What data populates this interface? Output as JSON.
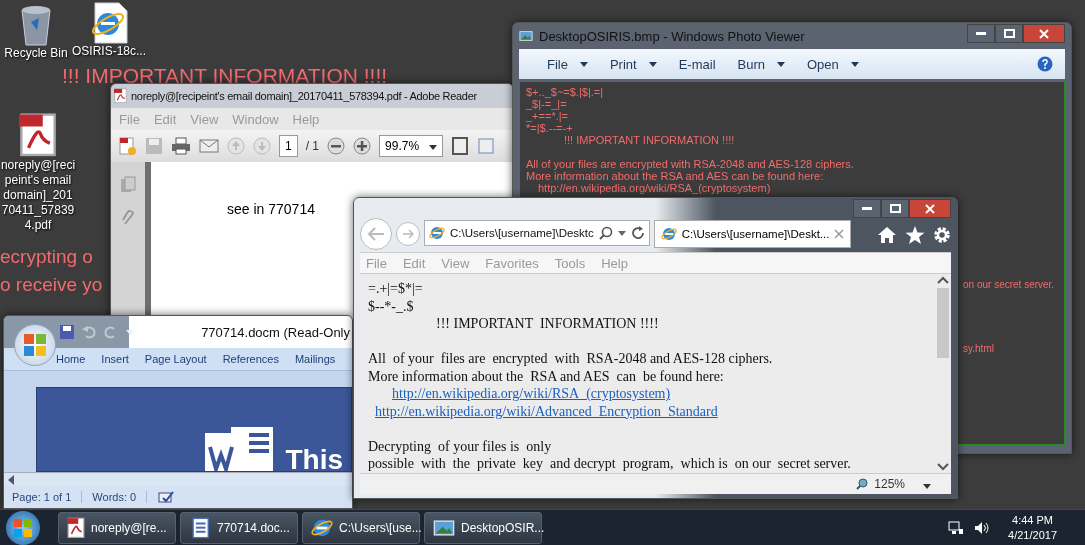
{
  "desktop": {
    "wallpaper_text": [
      "!!! IMPORTANT INFORMATION !!!!",
      "ecrypting o",
      "o receive yo"
    ],
    "icons": [
      {
        "kind": "recycle",
        "label": "Recycle Bin"
      },
      {
        "kind": "ie",
        "label": "OSIRIS-18c..."
      },
      {
        "kind": "pdf",
        "label": "noreply@[recipeint's email domain]_20170411_578394.pdf"
      }
    ]
  },
  "pdf_reader": {
    "title": "noreply@[recipeint's email domain]_20170411_578394.pdf - Adobe Reader",
    "menu": [
      {
        "label": "File",
        "disabled": true
      },
      {
        "label": "Edit",
        "disabled": true
      },
      {
        "label": "View",
        "disabled": true
      },
      {
        "label": "Window",
        "disabled": true
      },
      {
        "label": "Help",
        "disabled": true
      }
    ],
    "page": "1",
    "page_count": "/ 1",
    "zoom": "99.7%",
    "page_text": "see in 770714"
  },
  "photo_viewer": {
    "title": "DesktopOSIRIS.bmp - Windows Photo Viewer",
    "menu": [
      {
        "label": "File",
        "dropdown": true
      },
      {
        "label": "Print",
        "dropdown": true
      },
      {
        "label": "E-mail",
        "dropdown": false
      },
      {
        "label": "Burn",
        "dropdown": true
      },
      {
        "label": "Open",
        "dropdown": true
      }
    ],
    "lines": [
      {
        "kind": "text",
        "text": "$+.._$~=$.|$|.=|"
      },
      {
        "kind": "text",
        "text": "_$|-=_|="
      },
      {
        "kind": "text",
        "text": "_+==*.|="
      },
      {
        "kind": "text",
        "text": "*=|$.--=-+"
      },
      {
        "kind": "title",
        "text": "!!! IMPORTANT INFORMATION !!!!"
      },
      {
        "kind": "blank"
      },
      {
        "kind": "text",
        "text": "All of your files are encrypted with RSA-2048 and AES-128 ciphers."
      },
      {
        "kind": "text",
        "text": "More information about the RSA and AES can be found here:"
      },
      {
        "kind": "link",
        "text": "http://en.wikipedia.org/wiki/RSA_(cryptosystem)"
      }
    ],
    "fragments": [
      "on our secret server.",
      "sy.html"
    ]
  },
  "browser": {
    "address": "C:\\Users\\[username]\\Desktc",
    "tab": {
      "title": "C:\\Users\\[username]\\Deskt...",
      "selected": true
    },
    "menu": [
      "File",
      "Edit",
      "View",
      "Favorites",
      "Tools",
      "Help"
    ],
    "lines": [
      {
        "kind": "text",
        "text": "=.+|=$*|="
      },
      {
        "kind": "text",
        "text": "$--*-_.$"
      },
      {
        "kind": "title",
        "text": "!!! IMPORTANT  INFORMATION !!!!"
      },
      {
        "kind": "blank"
      },
      {
        "kind": "text",
        "text": "All  of your  files are  encrypted  with  RSA-2048 and AES-128 ciphers."
      },
      {
        "kind": "text",
        "text": "More information about the  RSA and AES  can  be found here:"
      },
      {
        "kind": "link",
        "text": "http://en.wikipedia.org/wiki/RSA_(cryptosystem)"
      },
      {
        "kind": "link2",
        "text": "http://en.wikipedia.org/wiki/Advanced_Encryption_Standard"
      },
      {
        "kind": "blank"
      },
      {
        "kind": "text",
        "text": "Decrypting  of your files is  only"
      },
      {
        "kind": "text",
        "text": "possible  with  the  private  key  and decrypt  program,  which is  on our  secret server."
      }
    ],
    "zoom": "125%"
  },
  "word": {
    "title": "770714.docm (Read-Only",
    "ribbon_tabs": [
      "Home",
      "Insert",
      "Page Layout",
      "References",
      "Mailings"
    ],
    "document_text": "This",
    "status": [
      "Page: 1 of 1",
      "Words: 0"
    ]
  },
  "taskbar": {
    "buttons": [
      {
        "kind": "pdf",
        "label": "noreply@[re..."
      },
      {
        "kind": "word",
        "label": "770714.doc..."
      },
      {
        "kind": "ie",
        "label": "C:\\Users\\[use..."
      },
      {
        "kind": "photo",
        "label": "DesktopOSIR..."
      }
    ],
    "time": "4:44 PM",
    "date": "4/21/2017"
  }
}
